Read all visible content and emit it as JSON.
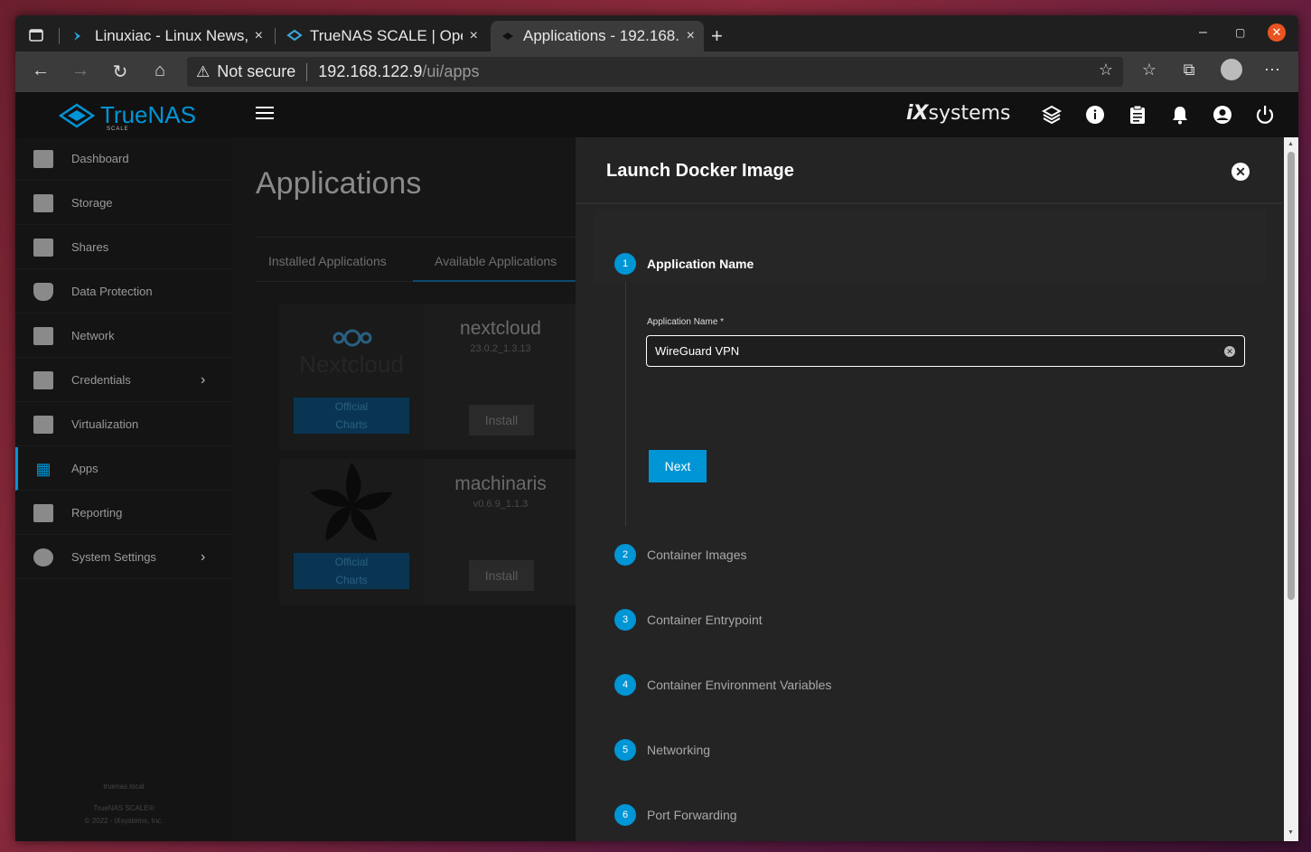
{
  "browser": {
    "tabs": [
      {
        "title": "Linuxiac - Linux News, T",
        "close": "×"
      },
      {
        "title": "TrueNAS SCALE | Ope",
        "close": "×"
      },
      {
        "title": "Applications - 192.168.",
        "close": "×"
      }
    ],
    "new_tab": "+",
    "address": {
      "warning_label": "Not secure",
      "host": "192.168.122.9",
      "path": "/ui/apps"
    }
  },
  "app": {
    "brand": "TrueNAS",
    "brand_sub": "SCALE",
    "vendor_prefix": "iX",
    "vendor": "systems",
    "sidebar": {
      "items": [
        {
          "label": "Dashboard"
        },
        {
          "label": "Storage"
        },
        {
          "label": "Shares"
        },
        {
          "label": "Data Protection"
        },
        {
          "label": "Network"
        },
        {
          "label": "Credentials",
          "has_submenu": true
        },
        {
          "label": "Virtualization"
        },
        {
          "label": "Apps",
          "active": true
        },
        {
          "label": "Reporting"
        },
        {
          "label": "System Settings",
          "has_submenu": true
        }
      ],
      "footer": {
        "host": "truenas.local",
        "product": "TrueNAS SCALE®",
        "copyright": "© 2022 - iXsystems, Inc."
      }
    },
    "main": {
      "title": "Applications",
      "tabs": [
        "Installed Applications",
        "Available Applications"
      ],
      "cards": [
        {
          "name": "nextcloud",
          "version": "23.0.2_1.3.13",
          "badge_line1": "Official",
          "badge_line2": "Charts",
          "install": "Install",
          "logo_text": "Nextcloud"
        },
        {
          "name": "machinaris",
          "version": "v0.6.9_1.1.3",
          "badge_line1": "Official",
          "badge_line2": "Charts",
          "install": "Install"
        }
      ]
    },
    "panel": {
      "title": "Launch Docker Image",
      "steps": [
        {
          "num": "1",
          "label": "Application Name",
          "active": true
        },
        {
          "num": "2",
          "label": "Container Images"
        },
        {
          "num": "3",
          "label": "Container Entrypoint"
        },
        {
          "num": "4",
          "label": "Container Environment Variables"
        },
        {
          "num": "5",
          "label": "Networking"
        },
        {
          "num": "6",
          "label": "Port Forwarding"
        }
      ],
      "field_label": "Application Name *",
      "field_value": "WireGuard VPN",
      "next_label": "Next"
    }
  },
  "colors": {
    "accent": "#0095d5",
    "ubuntu_orange": "#e95420"
  }
}
